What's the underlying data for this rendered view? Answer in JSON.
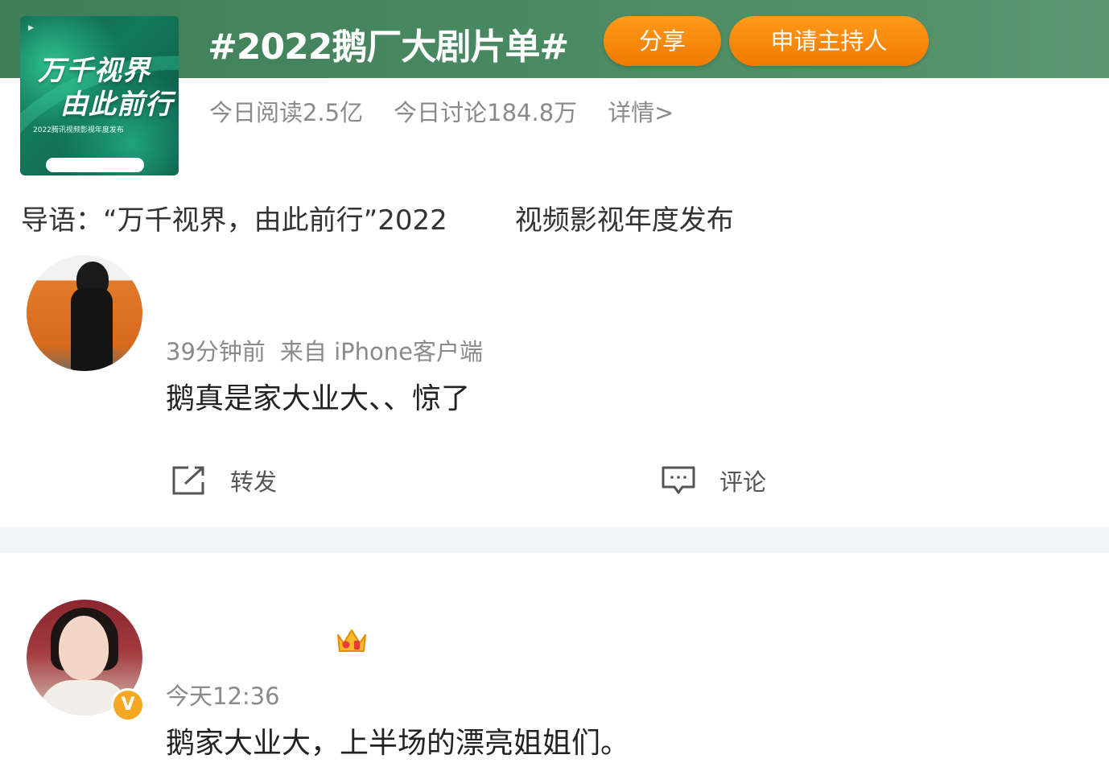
{
  "topic": {
    "title": "#2022鹅厂大剧片单#",
    "share_label": "分享",
    "apply_host_label": "申请主持人",
    "read_today": "今日阅读2.5亿",
    "discuss_today": "今日讨论184.8万",
    "details_link": "详情>",
    "intro_part1": "导语：“万千视界，由此前行”2022",
    "intro_part2": "视频影视年度发布",
    "cover": {
      "line1": "万千视界",
      "line2": "由此前行",
      "sub": "2022腾讯视频影视年度发布"
    }
  },
  "posts": [
    {
      "meta_time": "39分钟前",
      "meta_source": "来自 iPhone客户端",
      "text": "鹅真是家大业大、、惊了",
      "repost_label": "转发",
      "comment_label": "评论"
    },
    {
      "meta_time": "今天12:36",
      "text": "鹅家大业大，上半场的漂亮姐姐们。",
      "verified_badge": "V"
    }
  ],
  "colors": {
    "header_green": "#3f7f57",
    "button_orange": "#f07a00",
    "verified_gold": "#f7a823"
  },
  "icons": [
    "repost-icon",
    "comment-icon",
    "crown-icon",
    "verified-icon"
  ]
}
